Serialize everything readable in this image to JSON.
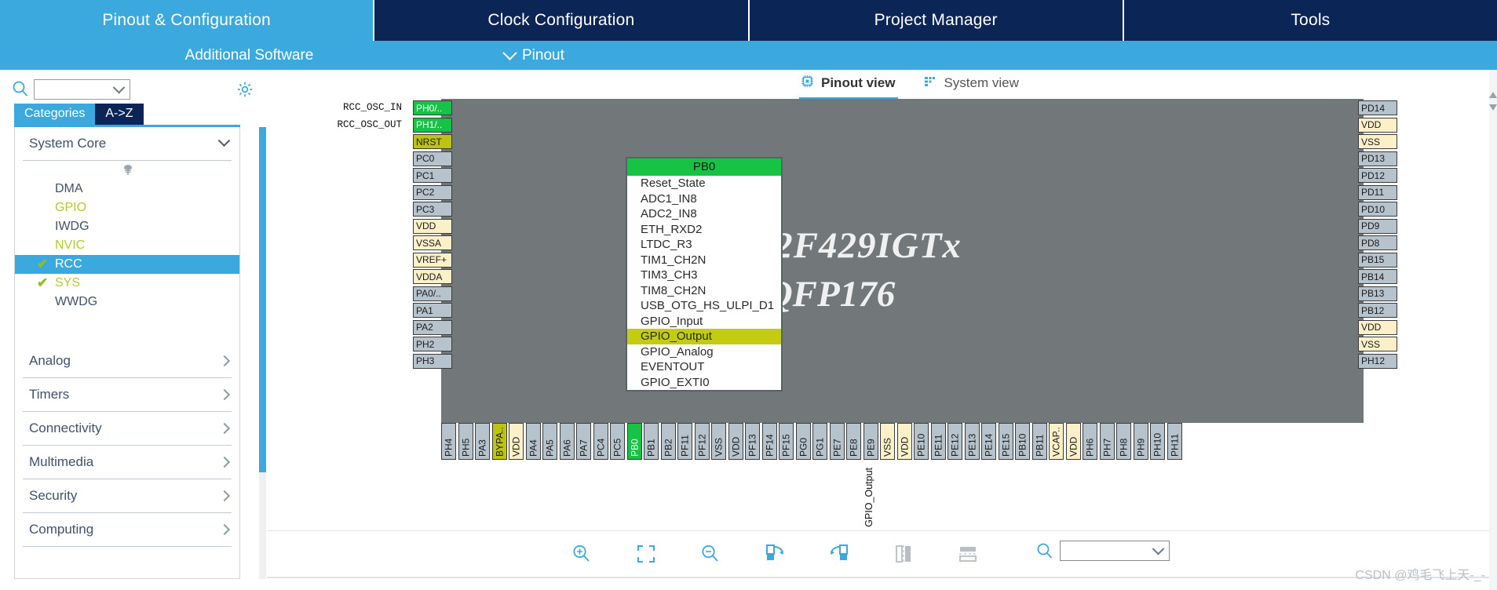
{
  "main_tabs": [
    {
      "label": "Pinout & Configuration",
      "active": true
    },
    {
      "label": "Clock Configuration",
      "active": false
    },
    {
      "label": "Project Manager",
      "active": false
    },
    {
      "label": "Tools",
      "active": false
    }
  ],
  "subbar": {
    "additional_software": "Additional Software",
    "pinout": "Pinout"
  },
  "sidebar": {
    "search_placeholder": "",
    "search_value": "",
    "tabs": [
      {
        "label": "Categories",
        "selected": true
      },
      {
        "label": "A->Z",
        "selected": false
      }
    ],
    "groups": [
      {
        "label": "System Core",
        "expanded": true,
        "items": [
          {
            "label": "DMA",
            "checked": false,
            "color": "dark",
            "selected": false
          },
          {
            "label": "GPIO",
            "checked": false,
            "color": "green",
            "selected": false
          },
          {
            "label": "IWDG",
            "checked": false,
            "color": "dark",
            "selected": false
          },
          {
            "label": "NVIC",
            "checked": false,
            "color": "green",
            "selected": false
          },
          {
            "label": "RCC",
            "checked": true,
            "color": "dark",
            "selected": true
          },
          {
            "label": "SYS",
            "checked": true,
            "color": "green",
            "selected": false
          },
          {
            "label": "WWDG",
            "checked": false,
            "color": "dark",
            "selected": false
          }
        ]
      },
      {
        "label": "Analog",
        "expanded": false,
        "items": []
      },
      {
        "label": "Timers",
        "expanded": false,
        "items": []
      },
      {
        "label": "Connectivity",
        "expanded": false,
        "items": []
      },
      {
        "label": "Multimedia",
        "expanded": false,
        "items": []
      },
      {
        "label": "Security",
        "expanded": false,
        "items": []
      },
      {
        "label": "Computing",
        "expanded": false,
        "items": []
      }
    ]
  },
  "view_tabs": [
    {
      "label": "Pinout view",
      "icon": "chip-icon",
      "active": true
    },
    {
      "label": "System view",
      "icon": "grid-icon",
      "active": false
    }
  ],
  "chip": {
    "name": "STM32F429IGTx",
    "package": "LQFP176",
    "left_labels": [
      "RCC_OSC_IN",
      "RCC_OSC_OUT",
      "",
      "",
      "",
      "",
      "",
      "",
      "",
      "",
      "",
      "",
      "",
      "",
      "",
      ""
    ],
    "pins_left": [
      {
        "label": "PH0/..",
        "style": "green"
      },
      {
        "label": "PH1/..",
        "style": "green"
      },
      {
        "label": "NRST",
        "style": "olive"
      },
      {
        "label": "PC0",
        "style": "gray"
      },
      {
        "label": "PC1",
        "style": "gray"
      },
      {
        "label": "PC2",
        "style": "gray"
      },
      {
        "label": "PC3",
        "style": "gray"
      },
      {
        "label": "VDD",
        "style": "cream"
      },
      {
        "label": "VSSA",
        "style": "cream"
      },
      {
        "label": "VREF+",
        "style": "cream"
      },
      {
        "label": "VDDA",
        "style": "cream"
      },
      {
        "label": "PA0/..",
        "style": "gray"
      },
      {
        "label": "PA1",
        "style": "gray"
      },
      {
        "label": "PA2",
        "style": "gray"
      },
      {
        "label": "PH2",
        "style": "gray"
      },
      {
        "label": "PH3",
        "style": "gray"
      }
    ],
    "pins_right": [
      {
        "label": "PD14",
        "style": "gray"
      },
      {
        "label": "VDD",
        "style": "cream"
      },
      {
        "label": "VSS",
        "style": "cream"
      },
      {
        "label": "PD13",
        "style": "gray"
      },
      {
        "label": "PD12",
        "style": "gray"
      },
      {
        "label": "PD11",
        "style": "gray"
      },
      {
        "label": "PD10",
        "style": "gray"
      },
      {
        "label": "PD9",
        "style": "gray"
      },
      {
        "label": "PD8",
        "style": "gray"
      },
      {
        "label": "PB15",
        "style": "gray"
      },
      {
        "label": "PB14",
        "style": "gray"
      },
      {
        "label": "PB13",
        "style": "gray"
      },
      {
        "label": "PB12",
        "style": "gray"
      },
      {
        "label": "VDD",
        "style": "cream"
      },
      {
        "label": "VSS",
        "style": "cream"
      },
      {
        "label": "PH12",
        "style": "gray"
      }
    ],
    "pins_bottom": [
      {
        "label": "PH4",
        "style": "gray"
      },
      {
        "label": "PH5",
        "style": "gray"
      },
      {
        "label": "PA3",
        "style": "gray"
      },
      {
        "label": "BYPA..",
        "style": "olive"
      },
      {
        "label": "VDD",
        "style": "cream"
      },
      {
        "label": "PA4",
        "style": "gray"
      },
      {
        "label": "PA5",
        "style": "gray"
      },
      {
        "label": "PA6",
        "style": "gray"
      },
      {
        "label": "PA7",
        "style": "gray"
      },
      {
        "label": "PC4",
        "style": "gray"
      },
      {
        "label": "PC5",
        "style": "gray"
      },
      {
        "label": "PB0",
        "style": "green"
      },
      {
        "label": "PB1",
        "style": "gray"
      },
      {
        "label": "PB2",
        "style": "gray"
      },
      {
        "label": "PF11",
        "style": "gray"
      },
      {
        "label": "PF12",
        "style": "gray"
      },
      {
        "label": "VSS",
        "style": "gray"
      },
      {
        "label": "VDD",
        "style": "gray"
      },
      {
        "label": "PF13",
        "style": "gray"
      },
      {
        "label": "PF14",
        "style": "gray"
      },
      {
        "label": "PF15",
        "style": "gray"
      },
      {
        "label": "PG0",
        "style": "gray"
      },
      {
        "label": "PG1",
        "style": "gray"
      },
      {
        "label": "PE7",
        "style": "gray"
      },
      {
        "label": "PE8",
        "style": "gray"
      },
      {
        "label": "PE9",
        "style": "gray"
      },
      {
        "label": "VSS",
        "style": "cream"
      },
      {
        "label": "VDD",
        "style": "cream"
      },
      {
        "label": "PE10",
        "style": "gray"
      },
      {
        "label": "PE11",
        "style": "gray"
      },
      {
        "label": "PE12",
        "style": "gray"
      },
      {
        "label": "PE13",
        "style": "gray"
      },
      {
        "label": "PE14",
        "style": "gray"
      },
      {
        "label": "PE15",
        "style": "gray"
      },
      {
        "label": "PB10",
        "style": "gray"
      },
      {
        "label": "PB11",
        "style": "gray"
      },
      {
        "label": "VCAP..",
        "style": "cream"
      },
      {
        "label": "VDD",
        "style": "cream"
      },
      {
        "label": "PH6",
        "style": "gray"
      },
      {
        "label": "PH7",
        "style": "gray"
      },
      {
        "label": "PH8",
        "style": "gray"
      },
      {
        "label": "PH9",
        "style": "gray"
      },
      {
        "label": "PH10",
        "style": "gray"
      },
      {
        "label": "PH11",
        "style": "gray"
      }
    ],
    "selected_pin_annotation": "GPIO_Output"
  },
  "dropdown": {
    "title": "PB0",
    "items": [
      {
        "label": "Reset_State",
        "highlighted": false
      },
      {
        "label": "ADC1_IN8",
        "highlighted": false
      },
      {
        "label": "ADC2_IN8",
        "highlighted": false
      },
      {
        "label": "ETH_RXD2",
        "highlighted": false
      },
      {
        "label": "LTDC_R3",
        "highlighted": false
      },
      {
        "label": "TIM1_CH2N",
        "highlighted": false
      },
      {
        "label": "TIM3_CH3",
        "highlighted": false
      },
      {
        "label": "TIM8_CH2N",
        "highlighted": false
      },
      {
        "label": "USB_OTG_HS_ULPI_D1",
        "highlighted": false
      },
      {
        "label": "GPIO_Input",
        "highlighted": false
      },
      {
        "label": "GPIO_Output",
        "highlighted": true
      },
      {
        "label": "GPIO_Analog",
        "highlighted": false
      },
      {
        "label": "EVENTOUT",
        "highlighted": false
      },
      {
        "label": "GPIO_EXTI0",
        "highlighted": false
      }
    ]
  },
  "toolbar": {
    "items": [
      {
        "name": "zoom-in-icon"
      },
      {
        "name": "fit-to-screen-icon"
      },
      {
        "name": "zoom-out-icon"
      },
      {
        "name": "rotate-right-icon"
      },
      {
        "name": "rotate-left-icon"
      },
      {
        "name": "flip-vertical-icon"
      },
      {
        "name": "flip-horizontal-icon"
      }
    ],
    "find_placeholder": "",
    "find_value": ""
  },
  "watermark": "CSDN @鸡毛飞上天-_-",
  "colors": {
    "accent": "#3ba9dd",
    "navy": "#0b2557",
    "pin_green": "#17c344",
    "pin_olive": "#bcc40f",
    "pin_gray": "#b6c2cc",
    "pin_cream": "#fbf0c8",
    "chip_body": "#72787a",
    "highlight": "#c2cd12"
  }
}
